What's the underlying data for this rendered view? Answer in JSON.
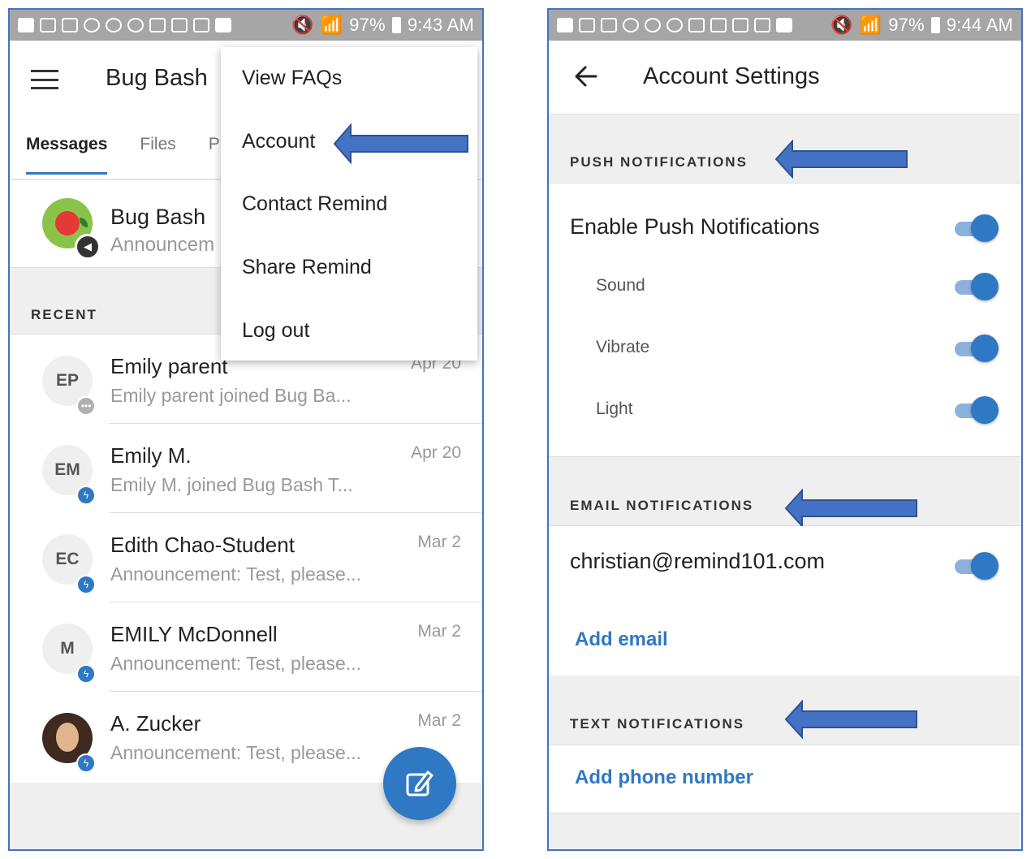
{
  "left": {
    "status_bar": {
      "battery": "97%",
      "time": "9:43 AM"
    },
    "title": "Bug Bash",
    "tabs": [
      "Messages",
      "Files",
      "P"
    ],
    "class_row": {
      "name": "Bug Bash",
      "subtitle": "Announcem"
    },
    "recent_label": "RECENT",
    "messages": [
      {
        "initials": "EP",
        "name": "Emily parent",
        "preview": "Emily parent joined Bug Ba...",
        "date": "Apr 20",
        "badge": "gray"
      },
      {
        "initials": "EM",
        "name": "Emily M.",
        "preview": "Emily M. joined Bug Bash T...",
        "date": "Apr 20",
        "badge": "blue"
      },
      {
        "initials": "EC",
        "name": "Edith Chao-Student",
        "preview": "Announcement: Test, please...",
        "date": "Mar 2",
        "badge": "blue"
      },
      {
        "initials": "M",
        "name": "EMILY McDonnell",
        "preview": "Announcement: Test, please...",
        "date": "Mar 2",
        "badge": "blue"
      },
      {
        "initials": "",
        "name": "A. Zucker",
        "preview": "Announcement: Test, please...",
        "date": "Mar 2",
        "badge": "blue"
      }
    ],
    "menu": [
      "View FAQs",
      "Account",
      "Contact Remind",
      "Share Remind",
      "Log out"
    ]
  },
  "right": {
    "status_bar": {
      "battery": "97%",
      "time": "9:44 AM"
    },
    "title": "Account Settings",
    "push": {
      "label": "PUSH NOTIFICATIONS",
      "enable": "Enable Push Notifications",
      "sound": "Sound",
      "vibrate": "Vibrate",
      "light": "Light"
    },
    "email": {
      "label": "EMAIL NOTIFICATIONS",
      "address": "christian@remind101.com",
      "add": "Add email"
    },
    "text": {
      "label": "TEXT NOTIFICATIONS",
      "add": "Add phone number"
    }
  },
  "colors": {
    "accent": "#2f78c4",
    "arrow": "#4472c4",
    "status_bar": "#a6a6a6"
  }
}
